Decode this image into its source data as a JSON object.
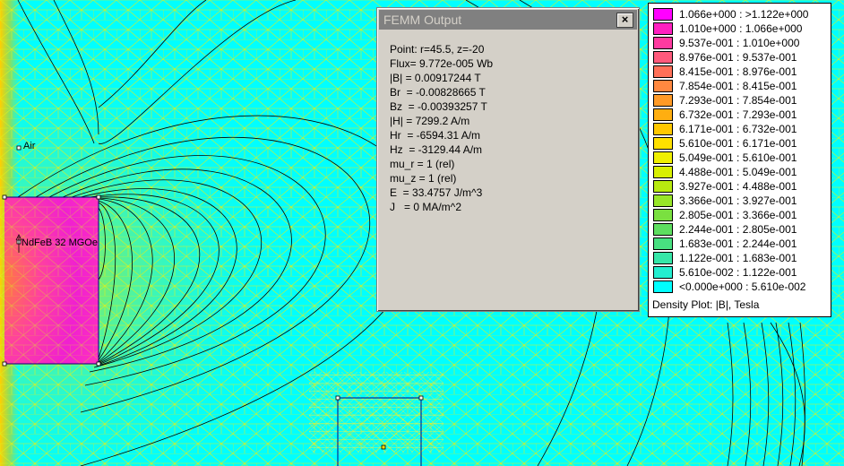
{
  "plot": {
    "label_air": "Air",
    "label_material": "NdFeB 32 MGOe"
  },
  "dialog": {
    "title": "FEMM Output",
    "close_label": "×",
    "lines": [
      "Point: r=45.5, z=-20",
      "Flux= 9.772e-005 Wb",
      "|B| = 0.00917244 T",
      "Br  = -0.00828665 T",
      "Bz  = -0.00393257 T",
      "|H| = 7299.2 A/m",
      "Hr  = -6594.31 A/m",
      "Hz  = -3129.44 A/m",
      "mu_r = 1 (rel)",
      "mu_z = 1 (rel)",
      "E  = 33.4757 J/m^3",
      "J   = 0 MA/m^2"
    ]
  },
  "legend": {
    "caption": "Density Plot: |B|, Tesla",
    "entries": [
      {
        "range": "1.066e+000 : >1.122e+000",
        "color": "#ff00ff"
      },
      {
        "range": "1.010e+000 : 1.066e+000",
        "color": "#ff20c0"
      },
      {
        "range": "9.537e-001 : 1.010e+000",
        "color": "#ff3aa0"
      },
      {
        "range": "8.976e-001 : 9.537e-001",
        "color": "#ff5a7c"
      },
      {
        "range": "8.415e-001 : 8.976e-001",
        "color": "#ff7058"
      },
      {
        "range": "7.854e-001 : 8.415e-001",
        "color": "#ff8840"
      },
      {
        "range": "7.293e-001 : 7.854e-001",
        "color": "#ff9a26"
      },
      {
        "range": "6.732e-001 : 7.293e-001",
        "color": "#ffae10"
      },
      {
        "range": "6.171e-001 : 6.732e-001",
        "color": "#ffc800"
      },
      {
        "range": "5.610e-001 : 6.171e-001",
        "color": "#ffe000"
      },
      {
        "range": "5.049e-001 : 5.610e-001",
        "color": "#f0f000"
      },
      {
        "range": "4.488e-001 : 5.049e-001",
        "color": "#d8f000"
      },
      {
        "range": "3.927e-001 : 4.488e-001",
        "color": "#b8ea10"
      },
      {
        "range": "3.366e-001 : 3.927e-001",
        "color": "#98e628"
      },
      {
        "range": "2.805e-001 : 3.366e-001",
        "color": "#7ae040"
      },
      {
        "range": "2.244e-001 : 2.805e-001",
        "color": "#5ede60"
      },
      {
        "range": "1.683e-001 : 2.244e-001",
        "color": "#48e080"
      },
      {
        "range": "1.122e-001 : 1.683e-001",
        "color": "#36e6a8"
      },
      {
        "range": "5.610e-002 : 1.122e-001",
        "color": "#24eed0"
      },
      {
        "range": "<0.000e+000 : 5.610e-002",
        "color": "#00ffff"
      }
    ]
  }
}
